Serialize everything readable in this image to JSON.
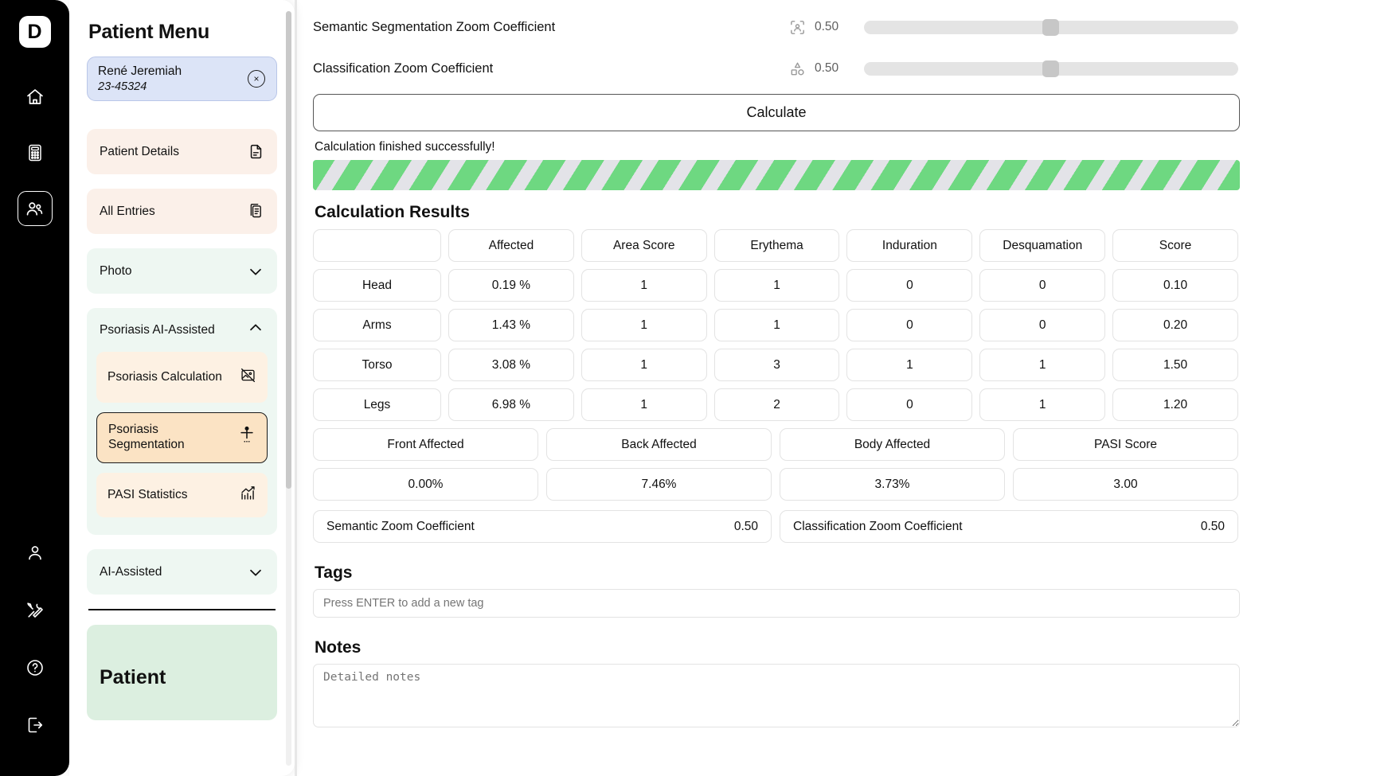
{
  "rail": {
    "logo_text": "D",
    "items": [
      {
        "name": "home-icon",
        "label": "Home"
      },
      {
        "name": "calculator-icon",
        "label": "Calculator"
      },
      {
        "name": "patients-icon",
        "label": "Patients",
        "active": true
      }
    ],
    "bottom_items": [
      {
        "name": "user-icon",
        "label": "Profile"
      },
      {
        "name": "tools-icon",
        "label": "Tools"
      },
      {
        "name": "help-icon",
        "label": "Help"
      },
      {
        "name": "logout-icon",
        "label": "Logout"
      }
    ]
  },
  "menu": {
    "title": "Patient Menu",
    "patient": {
      "name": "René Jeremiah",
      "id": "23-45324",
      "close_label": "×"
    },
    "items": [
      {
        "label": "Patient Details",
        "icon": "document-icon",
        "tone": "peach"
      },
      {
        "label": "All Entries",
        "icon": "clipboard-icon",
        "tone": "peach"
      }
    ],
    "photo_group": {
      "label": "Photo",
      "expanded": false
    },
    "psoriasis_group": {
      "label": "Psoriasis AI-Assisted",
      "expanded": true,
      "children": [
        {
          "label": "Psoriasis Calculation",
          "icon": "image-off-icon",
          "selected": false
        },
        {
          "label": "Psoriasis Segmentation",
          "icon": "body-figure-icon",
          "selected": true
        },
        {
          "label": "PASI Statistics",
          "icon": "chart-up-icon",
          "selected": false
        }
      ]
    },
    "ai_group": {
      "label": "AI-Assisted",
      "expanded": false
    },
    "bottom_card": {
      "label": "Patient"
    }
  },
  "main": {
    "sliders": [
      {
        "label": "Semantic Segmentation Zoom Coefficient",
        "icon": "person-scan-icon",
        "value": "0.50",
        "percent": 50
      },
      {
        "label": "Classification Zoom Coefficient",
        "icon": "shapes-icon",
        "value": "0.50",
        "percent": 50
      }
    ],
    "calculate_label": "Calculate",
    "status_message": "Calculation finished successfully!",
    "results_title": "Calculation Results",
    "table": {
      "headers": [
        "",
        "Affected",
        "Area Score",
        "Erythema",
        "Induration",
        "Desquamation",
        "Score"
      ],
      "rows": [
        [
          "Head",
          "0.19 %",
          "1",
          "1",
          "0",
          "0",
          "0.10"
        ],
        [
          "Arms",
          "1.43 %",
          "1",
          "1",
          "0",
          "0",
          "0.20"
        ],
        [
          "Torso",
          "3.08 %",
          "1",
          "3",
          "1",
          "1",
          "1.50"
        ],
        [
          "Legs",
          "6.98 %",
          "1",
          "2",
          "0",
          "1",
          "1.20"
        ]
      ]
    },
    "summary": {
      "headers": [
        "Front Affected",
        "Back Affected",
        "Body Affected",
        "PASI Score"
      ],
      "values": [
        "0.00%",
        "7.46%",
        "3.73%",
        "3.00"
      ]
    },
    "coefficients": [
      {
        "label": "Semantic Zoom Coefficient",
        "value": "0.50"
      },
      {
        "label": "Classification Zoom Coefficient",
        "value": "0.50"
      }
    ],
    "tags": {
      "title": "Tags",
      "placeholder": "Press ENTER to add a new tag",
      "value": ""
    },
    "notes": {
      "title": "Notes",
      "placeholder": "Detailed notes",
      "value": ""
    }
  },
  "colors": {
    "rail_bg": "#000000",
    "patient_card_bg": "#dce4f7",
    "peach": "#fbf0e9",
    "mint": "#eef7f2",
    "selected_sub": "#fbe3c4",
    "progress_green": "#6ed881"
  }
}
